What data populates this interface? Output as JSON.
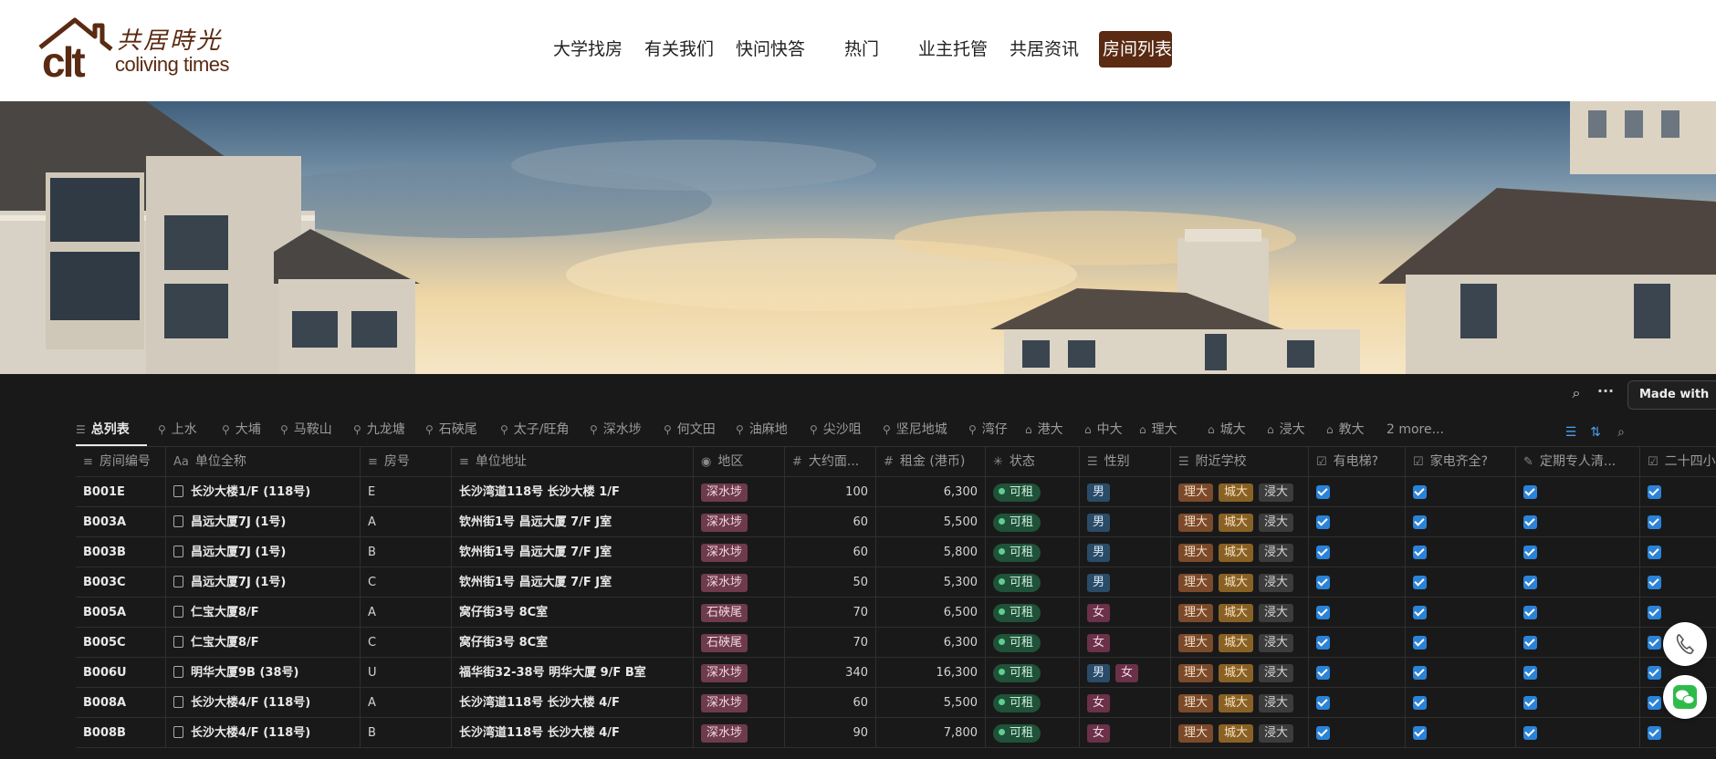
{
  "header": {
    "logo": {
      "mark": "clt",
      "cn": "共居時光",
      "en": "coliving times"
    },
    "nav": [
      {
        "label": "大学找房"
      },
      {
        "label": "有关我们"
      },
      {
        "label": "快问快答"
      },
      {
        "label": "热门"
      },
      {
        "label": "业主托管"
      },
      {
        "label": "共居资讯"
      },
      {
        "label": "房间列表",
        "active": true
      }
    ]
  },
  "notion": {
    "made_with": "Made with",
    "top_icons": [
      "search-icon",
      "more-icon"
    ],
    "tabs": [
      {
        "label": "总列表",
        "icon": "database-icon",
        "active": true
      },
      {
        "label": "上水",
        "icon": "pin-icon"
      },
      {
        "label": "大埔",
        "icon": "pin-icon"
      },
      {
        "label": "马鞍山",
        "icon": "pin-icon"
      },
      {
        "label": "九龙塘",
        "icon": "pin-icon"
      },
      {
        "label": "石硤尾",
        "icon": "pin-icon"
      },
      {
        "label": "太子/旺角",
        "icon": "pin-icon"
      },
      {
        "label": "深水埗",
        "icon": "pin-icon"
      },
      {
        "label": "何文田",
        "icon": "pin-icon"
      },
      {
        "label": "油麻地",
        "icon": "pin-icon"
      },
      {
        "label": "尖沙咀",
        "icon": "pin-icon"
      },
      {
        "label": "坚尼地城",
        "icon": "pin-icon"
      },
      {
        "label": "湾仔",
        "icon": "pin-icon"
      },
      {
        "label": "港大",
        "icon": "school-icon"
      },
      {
        "label": "中大",
        "icon": "school-icon"
      },
      {
        "label": "理大",
        "icon": "school-icon"
      },
      {
        "label": "城大",
        "icon": "school-icon"
      },
      {
        "label": "浸大",
        "icon": "school-icon"
      },
      {
        "label": "教大",
        "icon": "school-icon"
      }
    ],
    "more_tabs": "2 more...",
    "toolbar_icons": [
      "filter-icon",
      "sort-icon",
      "search-icon"
    ],
    "columns": [
      {
        "label": "房间编号",
        "icon": "≡"
      },
      {
        "label": "单位全称",
        "icon": "Aa"
      },
      {
        "label": "房号",
        "icon": "≡"
      },
      {
        "label": "单位地址",
        "icon": "≡"
      },
      {
        "label": "地区",
        "icon": "◉"
      },
      {
        "label": "大约面...",
        "icon": "#"
      },
      {
        "label": "租金 (港币)",
        "icon": "#"
      },
      {
        "label": "状态",
        "icon": "✳"
      },
      {
        "label": "性别",
        "icon": "☰"
      },
      {
        "label": "附近学校",
        "icon": "☰"
      },
      {
        "label": "有电梯?",
        "icon": "☑"
      },
      {
        "label": "家电齐全?",
        "icon": "☑"
      },
      {
        "label": "定期专人清...",
        "icon": "✎"
      },
      {
        "label": "二十四小",
        "icon": "☑"
      }
    ],
    "status_label": "可租",
    "rows": [
      {
        "id": "B001E",
        "name": "长沙大楼1/F (118号)",
        "room": "E",
        "address": "长沙湾道118号 长沙大楼 1/F",
        "region": "深水埗",
        "area": "100",
        "rent": "6,300",
        "gender": [
          "男"
        ],
        "schools": [
          "理大",
          "城大",
          "浸大"
        ]
      },
      {
        "id": "B003A",
        "name": "昌远大厦7J (1号)",
        "room": "A",
        "address": "钦州街1号 昌远大厦 7/F J室",
        "region": "深水埗",
        "area": "60",
        "rent": "5,500",
        "gender": [
          "男"
        ],
        "schools": [
          "理大",
          "城大",
          "浸大"
        ]
      },
      {
        "id": "B003B",
        "name": "昌远大厦7J (1号)",
        "room": "B",
        "address": "钦州街1号 昌远大厦 7/F J室",
        "region": "深水埗",
        "area": "60",
        "rent": "5,800",
        "gender": [
          "男"
        ],
        "schools": [
          "理大",
          "城大",
          "浸大"
        ]
      },
      {
        "id": "B003C",
        "name": "昌远大厦7J (1号)",
        "room": "C",
        "address": "钦州街1号 昌远大厦 7/F J室",
        "region": "深水埗",
        "area": "50",
        "rent": "5,300",
        "gender": [
          "男"
        ],
        "schools": [
          "理大",
          "城大",
          "浸大"
        ]
      },
      {
        "id": "B005A",
        "name": "仁宝大厦8/F",
        "room": "A",
        "address": "窝仔街3号 8C室",
        "region": "石硤尾",
        "area": "70",
        "rent": "6,500",
        "gender": [
          "女"
        ],
        "schools": [
          "理大",
          "城大",
          "浸大"
        ]
      },
      {
        "id": "B005C",
        "name": "仁宝大厦8/F",
        "room": "C",
        "address": "窝仔街3号 8C室",
        "region": "石硤尾",
        "area": "70",
        "rent": "6,300",
        "gender": [
          "女"
        ],
        "schools": [
          "理大",
          "城大",
          "浸大"
        ]
      },
      {
        "id": "B006U",
        "name": "明华大厦9B (38号)",
        "room": "U",
        "address": "福华街32-38号 明华大厦 9/F B室",
        "region": "深水埗",
        "area": "340",
        "rent": "16,300",
        "gender": [
          "男",
          "女"
        ],
        "schools": [
          "理大",
          "城大",
          "浸大"
        ]
      },
      {
        "id": "B008A",
        "name": "长沙大楼4/F (118号)",
        "room": "A",
        "address": "长沙湾道118号 长沙大楼 4/F",
        "region": "深水埗",
        "area": "60",
        "rent": "5,500",
        "gender": [
          "女"
        ],
        "schools": [
          "理大",
          "城大",
          "浸大"
        ]
      },
      {
        "id": "B008B",
        "name": "长沙大楼4/F (118号)",
        "room": "B",
        "address": "长沙湾道118号 长沙大楼 4/F",
        "region": "深水埗",
        "area": "90",
        "rent": "7,800",
        "gender": [
          "女"
        ],
        "schools": [
          "理大",
          "城大",
          "浸大"
        ]
      }
    ],
    "fab": [
      "phone-icon",
      "wechat-icon"
    ]
  }
}
